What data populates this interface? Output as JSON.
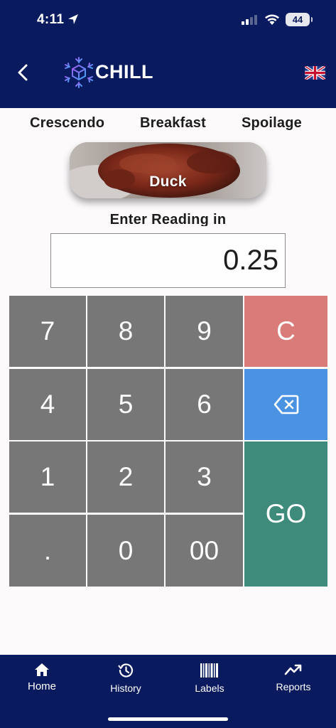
{
  "status_bar": {
    "time": "4:11",
    "battery": "44",
    "location_icon": "location-arrow-icon",
    "signal_icon": "cellular-signal-icon",
    "wifi_icon": "wifi-icon"
  },
  "header": {
    "brand": "CHILL",
    "back_icon": "chevron-left-icon",
    "logo_icon": "snowflake-cube-logo",
    "language_icon": "uk-flag-icon"
  },
  "categories": [
    "Crescendo",
    "Breakfast",
    "Spoilage"
  ],
  "food": {
    "name": "Duck"
  },
  "reading": {
    "label": "Enter Reading in",
    "value": "0.25"
  },
  "keypad": {
    "keys": {
      "k7": "7",
      "k8": "8",
      "k9": "9",
      "clear": "C",
      "k4": "4",
      "k5": "5",
      "k6": "6",
      "backspace_icon": "backspace-icon",
      "k1": "1",
      "k2": "2",
      "k3": "3",
      "go": "GO",
      "dot": ".",
      "k0": "0",
      "k00": "00"
    }
  },
  "tabs": [
    {
      "label": "Home",
      "icon": "home-icon"
    },
    {
      "label": "History",
      "icon": "history-icon"
    },
    {
      "label": "Labels",
      "icon": "barcode-icon"
    },
    {
      "label": "Reports",
      "icon": "trend-chart-icon"
    }
  ],
  "colors": {
    "navy": "#0a1a5e",
    "key_gray": "#777777",
    "clear_red": "#d97b78",
    "backspace_blue": "#4a93e3",
    "go_green": "#3e8a7b"
  }
}
